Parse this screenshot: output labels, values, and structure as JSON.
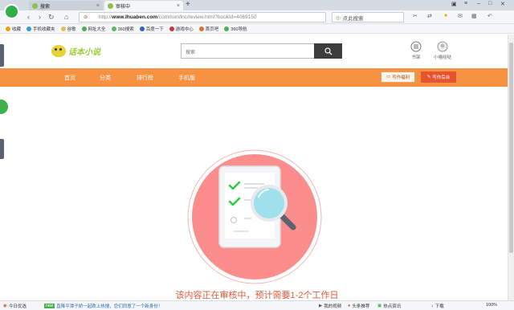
{
  "browser": {
    "tabs": [
      {
        "label": "搜索"
      },
      {
        "label": "审核中"
      }
    ],
    "new_tab_symbol": "+",
    "url": {
      "prefix": "http://",
      "host": "www.lhuaben.com",
      "path": "/common/lnc/review.html?bookId=4069150"
    },
    "search_placeholder": "点此搜索",
    "bookmarks": [
      {
        "label": "收藏",
        "icon": "star-icon",
        "color": "#f0a000"
      },
      {
        "label": "手机收藏夹",
        "icon": "phone-icon",
        "color": "#3a9ad9"
      },
      {
        "label": "谷歌",
        "icon": "folder-icon",
        "color": "#e0c060"
      },
      {
        "label": "网址大全",
        "icon": "globe-icon",
        "color": "#4caf50"
      },
      {
        "label": "360搜索",
        "icon": "search-icon",
        "color": "#5cb85c"
      },
      {
        "label": "百度一下",
        "icon": "paw-icon",
        "color": "#3060d0"
      },
      {
        "label": "游戏中心",
        "icon": "game-icon",
        "color": "#d03030"
      },
      {
        "label": "首页吧",
        "icon": "home-icon",
        "color": "#e07030"
      },
      {
        "label": "360导航",
        "icon": "nav-icon",
        "color": "#4caf50"
      }
    ]
  },
  "site": {
    "logo_text": "话本小说",
    "search_placeholder": "搜索",
    "header_icons": [
      {
        "label": "书架",
        "icon": "bookshelf-icon"
      },
      {
        "label": "小喵哒哒",
        "icon": "avatar-icon"
      }
    ],
    "menu": [
      "首页",
      "分类",
      "排行榜",
      "手机版"
    ],
    "fav_button": "写作福利",
    "write_button": "写作后台",
    "review_message": "该内容正在审核中，预计需要1-2个工作日"
  },
  "status_bar": {
    "left": "今日优选",
    "news_badge": "new",
    "news": "直降平潭子娇一起跌上热搜，您们同意了一个新身份！",
    "items": [
      "我的视频",
      "头条推荐",
      "热点资讯",
      "下载"
    ],
    "zoom": "100%"
  },
  "colors": {
    "orange": "#f79243",
    "red": "#e5532f",
    "circle": "#fb8d8d",
    "green": "#2ecc40",
    "magnifier": "#7fd3e0"
  }
}
